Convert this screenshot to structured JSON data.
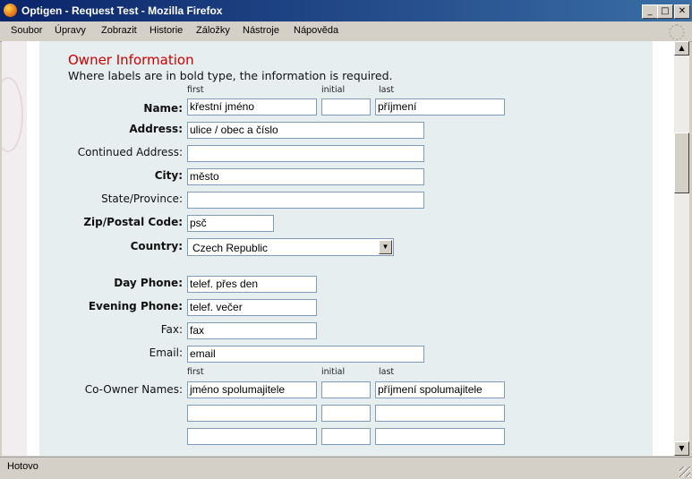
{
  "window": {
    "title": "Optigen - Request Test - Mozilla Firefox",
    "minimize": "_",
    "maximize": "□",
    "close": "✕"
  },
  "menu": [
    "Soubor",
    "Úpravy",
    "Zobrazit",
    "Historie",
    "Záložky",
    "Nástroje",
    "Nápověda"
  ],
  "form": {
    "heading": "Owner Information",
    "note": "Where labels are in bold type, the information is required.",
    "sub_first": "first",
    "sub_initial": "initial",
    "sub_last": "last",
    "name_label": "Name:",
    "name_first": "křestní jméno",
    "name_initial": "",
    "name_last": "příjmení",
    "address_label": "Address:",
    "address_value": "ulice / obec a číslo",
    "address2_label": "Continued Address:",
    "address2_value": "",
    "city_label": "City:",
    "city_value": "město",
    "state_label": "State/Province:",
    "state_value": "",
    "zip_label": "Zip/Postal Code:",
    "zip_value": "psč",
    "country_label": "Country:",
    "country_value": "Czech Republic",
    "dayphone_label": "Day Phone:",
    "dayphone_value": "telef. přes den",
    "evephone_label": "Evening Phone:",
    "evephone_value": "telef. večer",
    "fax_label": "Fax:",
    "fax_value": "fax",
    "email_label": "Email:",
    "email_value": "email",
    "coowner_label": "Co-Owner Names:",
    "coowners": [
      {
        "first": "jméno spolumajitele",
        "initial": "",
        "last": "příjmení spolumajitele"
      },
      {
        "first": "",
        "initial": "",
        "last": ""
      },
      {
        "first": "",
        "initial": "",
        "last": ""
      }
    ]
  },
  "status": "Hotovo"
}
